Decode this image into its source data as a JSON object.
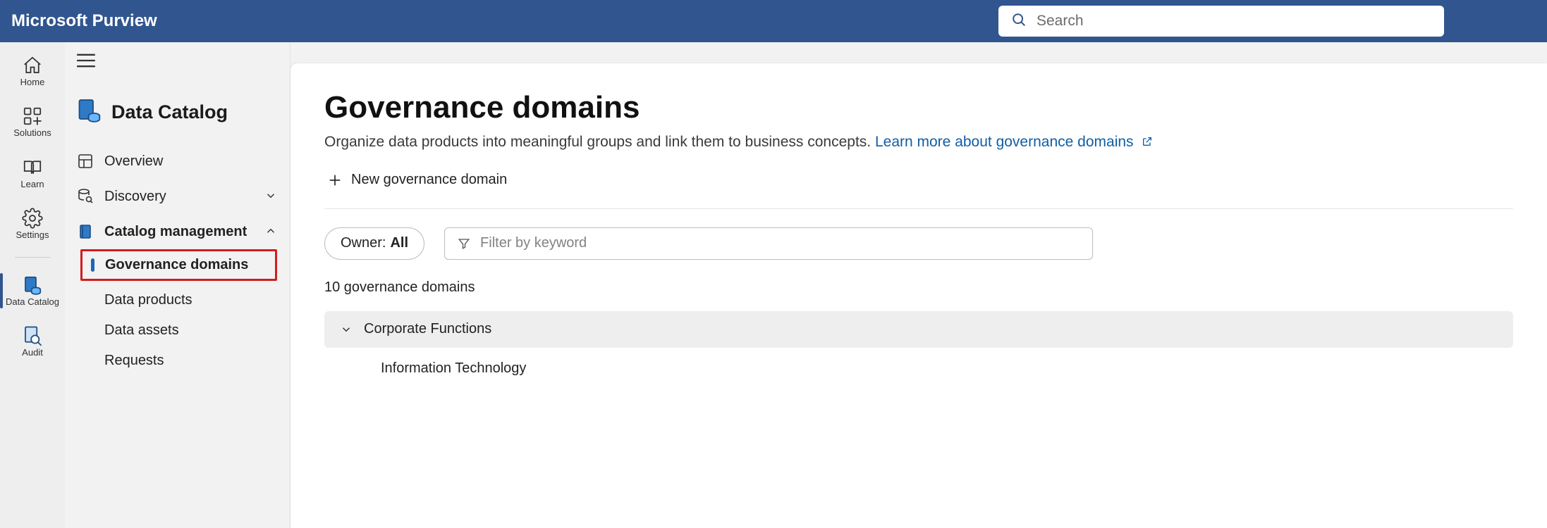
{
  "brand": "Microsoft Purview",
  "search": {
    "placeholder": "Search"
  },
  "rail": {
    "home": "Home",
    "solutions": "Solutions",
    "learn": "Learn",
    "settings": "Settings",
    "data_catalog": "Data Catalog",
    "audit": "Audit"
  },
  "panel2": {
    "title": "Data Catalog",
    "overview": "Overview",
    "discovery": "Discovery",
    "catalog_mgmt": "Catalog management",
    "sub": {
      "governance_domains": "Governance domains",
      "data_products": "Data products",
      "data_assets": "Data assets",
      "requests": "Requests"
    }
  },
  "main": {
    "title": "Governance domains",
    "subtitle_plain": "Organize data products into meaningful groups and link them to business concepts. ",
    "subtitle_link": "Learn more about governance domains",
    "new_button": "New governance domain",
    "owner_pill_label": "Owner: ",
    "owner_pill_value": "All",
    "filter_placeholder": "Filter by keyword",
    "count": "10 governance domains",
    "group1_head": "Corporate Functions",
    "group1_child1": "Information Technology"
  }
}
